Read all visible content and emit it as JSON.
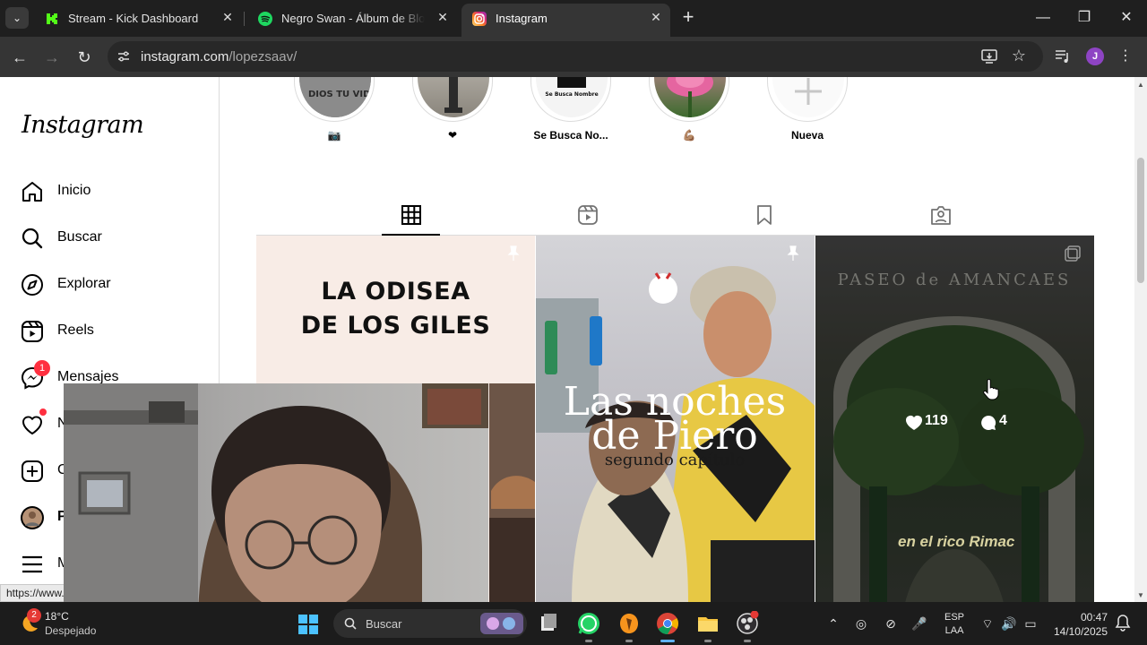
{
  "browser": {
    "tabs": [
      {
        "title": "Stream - Kick Dashboard",
        "favicon": "kick-icon",
        "active": false
      },
      {
        "title": "Negro Swan - Álbum de Blood Orange",
        "favicon": "spotify-icon",
        "active": false
      },
      {
        "title": "Instagram",
        "favicon": "instagram-icon",
        "active": true
      }
    ],
    "url_host": "instagram.com",
    "url_path": "/lopezsaav/",
    "profile_initial": "J",
    "status_url": "https://www..."
  },
  "instagram": {
    "logo": "Instagram",
    "nav": [
      {
        "label": "Inicio",
        "icon": "home-icon"
      },
      {
        "label": "Buscar",
        "icon": "search-icon"
      },
      {
        "label": "Explorar",
        "icon": "compass-icon"
      },
      {
        "label": "Reels",
        "icon": "reels-icon"
      },
      {
        "label": "Mensajes",
        "icon": "messenger-icon",
        "badge": "1"
      },
      {
        "label": "N",
        "icon": "heart-icon"
      },
      {
        "label": "C",
        "icon": "create-icon"
      },
      {
        "label": "P",
        "icon": "profile-avatar"
      },
      {
        "label": "M",
        "icon": "menu-icon"
      }
    ],
    "highlights": [
      {
        "caption": "📷"
      },
      {
        "caption": "❤"
      },
      {
        "caption": "Se Busca No...",
        "inner_text": "Se Busca Nombre"
      },
      {
        "caption": "💪🏽"
      },
      {
        "caption": "Nueva"
      }
    ],
    "highlight1_text": "DIOS TU VIDA",
    "posts": {
      "post1_headline_1": "LA ODISEA",
      "post1_headline_2": "DE LOS GILES",
      "post2_title_1": "Las noches",
      "post2_title_2": "de Piero",
      "post2_subtitle": "segundo capítulo",
      "post3_likes": "119",
      "post3_comments": "4",
      "post3_caption": "en el rico Rimac",
      "post3_arch_text": "PASEO de AMANCAES"
    }
  },
  "taskbar": {
    "weather_badge": "2",
    "temperature": "18°C",
    "condition": "Despejado",
    "search_label": "Buscar",
    "lang_1": "ESP",
    "lang_2": "LAA",
    "time": "00:47",
    "date": "14/10/2025"
  },
  "colors": {
    "chrome_dark": "#1f1f1f",
    "chrome_toolbar": "#353535",
    "ig_notification": "#ff3040",
    "profile_purple": "#8e44c4"
  }
}
